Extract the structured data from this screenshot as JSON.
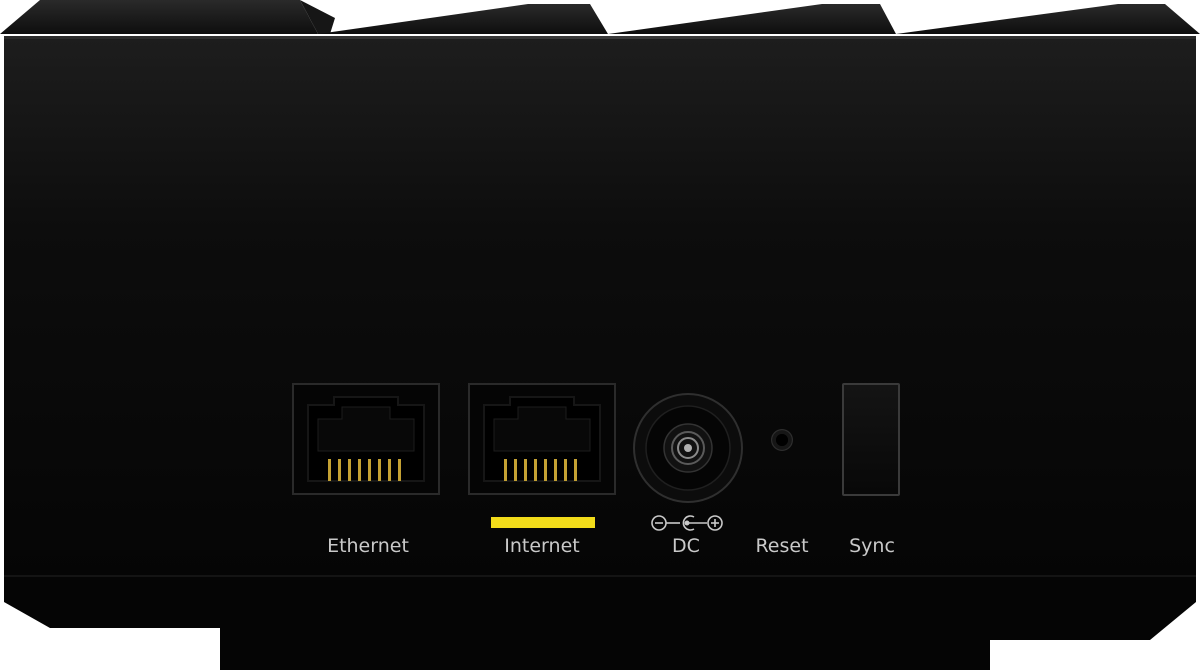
{
  "device": {
    "description": "Router rear panel",
    "body_color": "#0a0a0a",
    "indicator_color": "#f2dc1a",
    "label_color": "#c9c9c9",
    "ports": [
      {
        "id": "ethernet",
        "label": "Ethernet",
        "type": "rj45"
      },
      {
        "id": "internet",
        "label": "Internet",
        "type": "rj45",
        "indicator": "yellow-bar"
      },
      {
        "id": "dc",
        "label": "DC",
        "type": "barrel-jack",
        "polarity_symbol": "center-positive"
      },
      {
        "id": "reset",
        "label": "Reset",
        "type": "pinhole"
      },
      {
        "id": "sync",
        "label": "Sync",
        "type": "push-button"
      }
    ]
  }
}
